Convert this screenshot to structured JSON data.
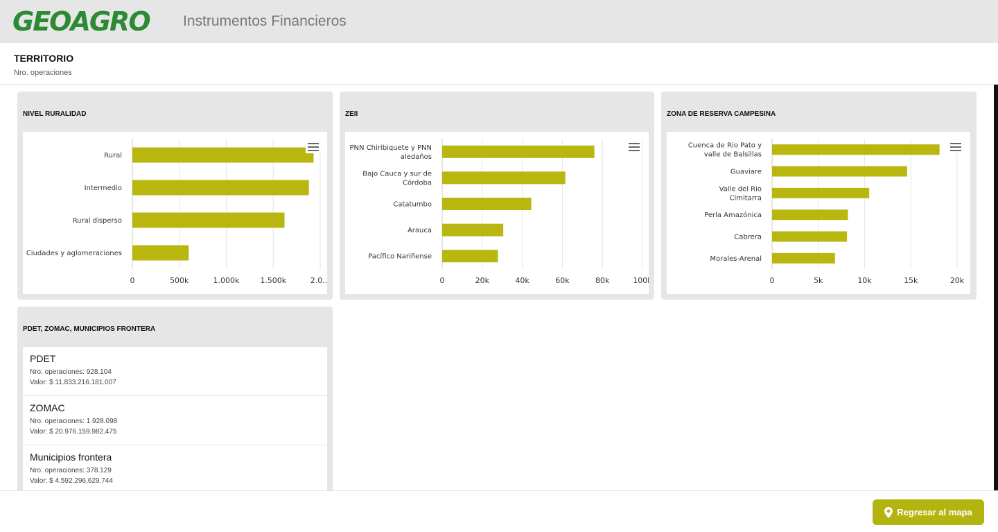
{
  "header": {
    "logo_text": "GEOAGRO",
    "app_title": "Instrumentos Financieros"
  },
  "section": {
    "title": "TERRITORIO",
    "subtitle": "Nro. operaciones"
  },
  "colors": {
    "bar": "#b9b60f",
    "header_bg": "#e6e6e6",
    "logo": "#2d8a34",
    "button": "#b4b411"
  },
  "icons": {
    "chart_menu": "hamburger-menu-icon",
    "back_button": "map-pin-icon"
  },
  "chart_data": [
    {
      "type": "bar",
      "orientation": "horizontal",
      "title": "NIVEL RURALIDAD",
      "categories": [
        "Rural",
        "Intermedio",
        "Rural disperso",
        "Ciudades y aglomeraciones"
      ],
      "values": [
        1930000,
        1880000,
        1620000,
        600000
      ],
      "xlim": [
        0,
        2000000
      ],
      "ticks": [
        "0",
        "500k",
        "1.000k",
        "1.500k",
        "2.0…"
      ],
      "grid": true
    },
    {
      "type": "bar",
      "orientation": "horizontal",
      "title": "ZEII",
      "categories": [
        "PNN Chiribiquete y PNN aledaños",
        "Bajo Cauca y sur de Córdoba",
        "Catatumbo",
        "Arauca",
        "Pacífico Nariñense"
      ],
      "values": [
        76000,
        61500,
        44500,
        30500,
        27800
      ],
      "xlim": [
        0,
        100000
      ],
      "ticks": [
        "0",
        "20k",
        "40k",
        "60k",
        "80k",
        "100k"
      ],
      "grid": true
    },
    {
      "type": "bar",
      "orientation": "horizontal",
      "title": "ZONA DE RESERVA CAMPESINA",
      "categories": [
        "Cuenca de Rio Pato y valle de Balsillas",
        "Guaviare",
        "Valle del Rio Cimitarra",
        "Perla Amazónica",
        "Cabrera",
        "Morales-Arenal"
      ],
      "values": [
        18100,
        14600,
        10500,
        8200,
        8100,
        6800
      ],
      "xlim": [
        0,
        20000
      ],
      "ticks": [
        "0",
        "5k",
        "10k",
        "15k",
        "20k"
      ],
      "grid": true
    }
  ],
  "list_panel": {
    "title": "PDET, ZOMAC, MUNICIPIOS FRONTERA",
    "items": [
      {
        "name": "PDET",
        "ops": "Nro. operaciones: 928.104",
        "valor": "Valor: $ 11.833.216.181.007"
      },
      {
        "name": "ZOMAC",
        "ops": "Nro. operaciones: 1.928.098",
        "valor": "Valor: $ 20.976.159.982.475"
      },
      {
        "name": "Municipios frontera",
        "ops": "Nro. operaciones: 378.129",
        "valor": "Valor: $ 4.592.296.629.744"
      }
    ]
  },
  "footer": {
    "back_label": "Regresar al mapa"
  }
}
